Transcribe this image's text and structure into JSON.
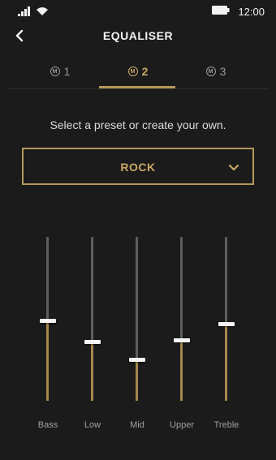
{
  "status_bar": {
    "time": "12:00"
  },
  "header": {
    "title": "EQUALISER"
  },
  "tabs": [
    {
      "badge": "M",
      "label": "1",
      "active": false
    },
    {
      "badge": "M",
      "label": "2",
      "active": true
    },
    {
      "badge": "M",
      "label": "3",
      "active": false
    }
  ],
  "prompt": "Select a preset or create your own.",
  "preset": {
    "value": "ROCK"
  },
  "equalizer": {
    "bands": [
      {
        "label": "Bass",
        "level": 0.49
      },
      {
        "label": "Low",
        "level": 0.36
      },
      {
        "label": "Mid",
        "level": 0.25
      },
      {
        "label": "Upper",
        "level": 0.37
      },
      {
        "label": "Treble",
        "level": 0.47
      }
    ]
  },
  "colors": {
    "accent": "#c9a864",
    "accent_line": "#b5975a",
    "background": "#1b1b1b"
  }
}
